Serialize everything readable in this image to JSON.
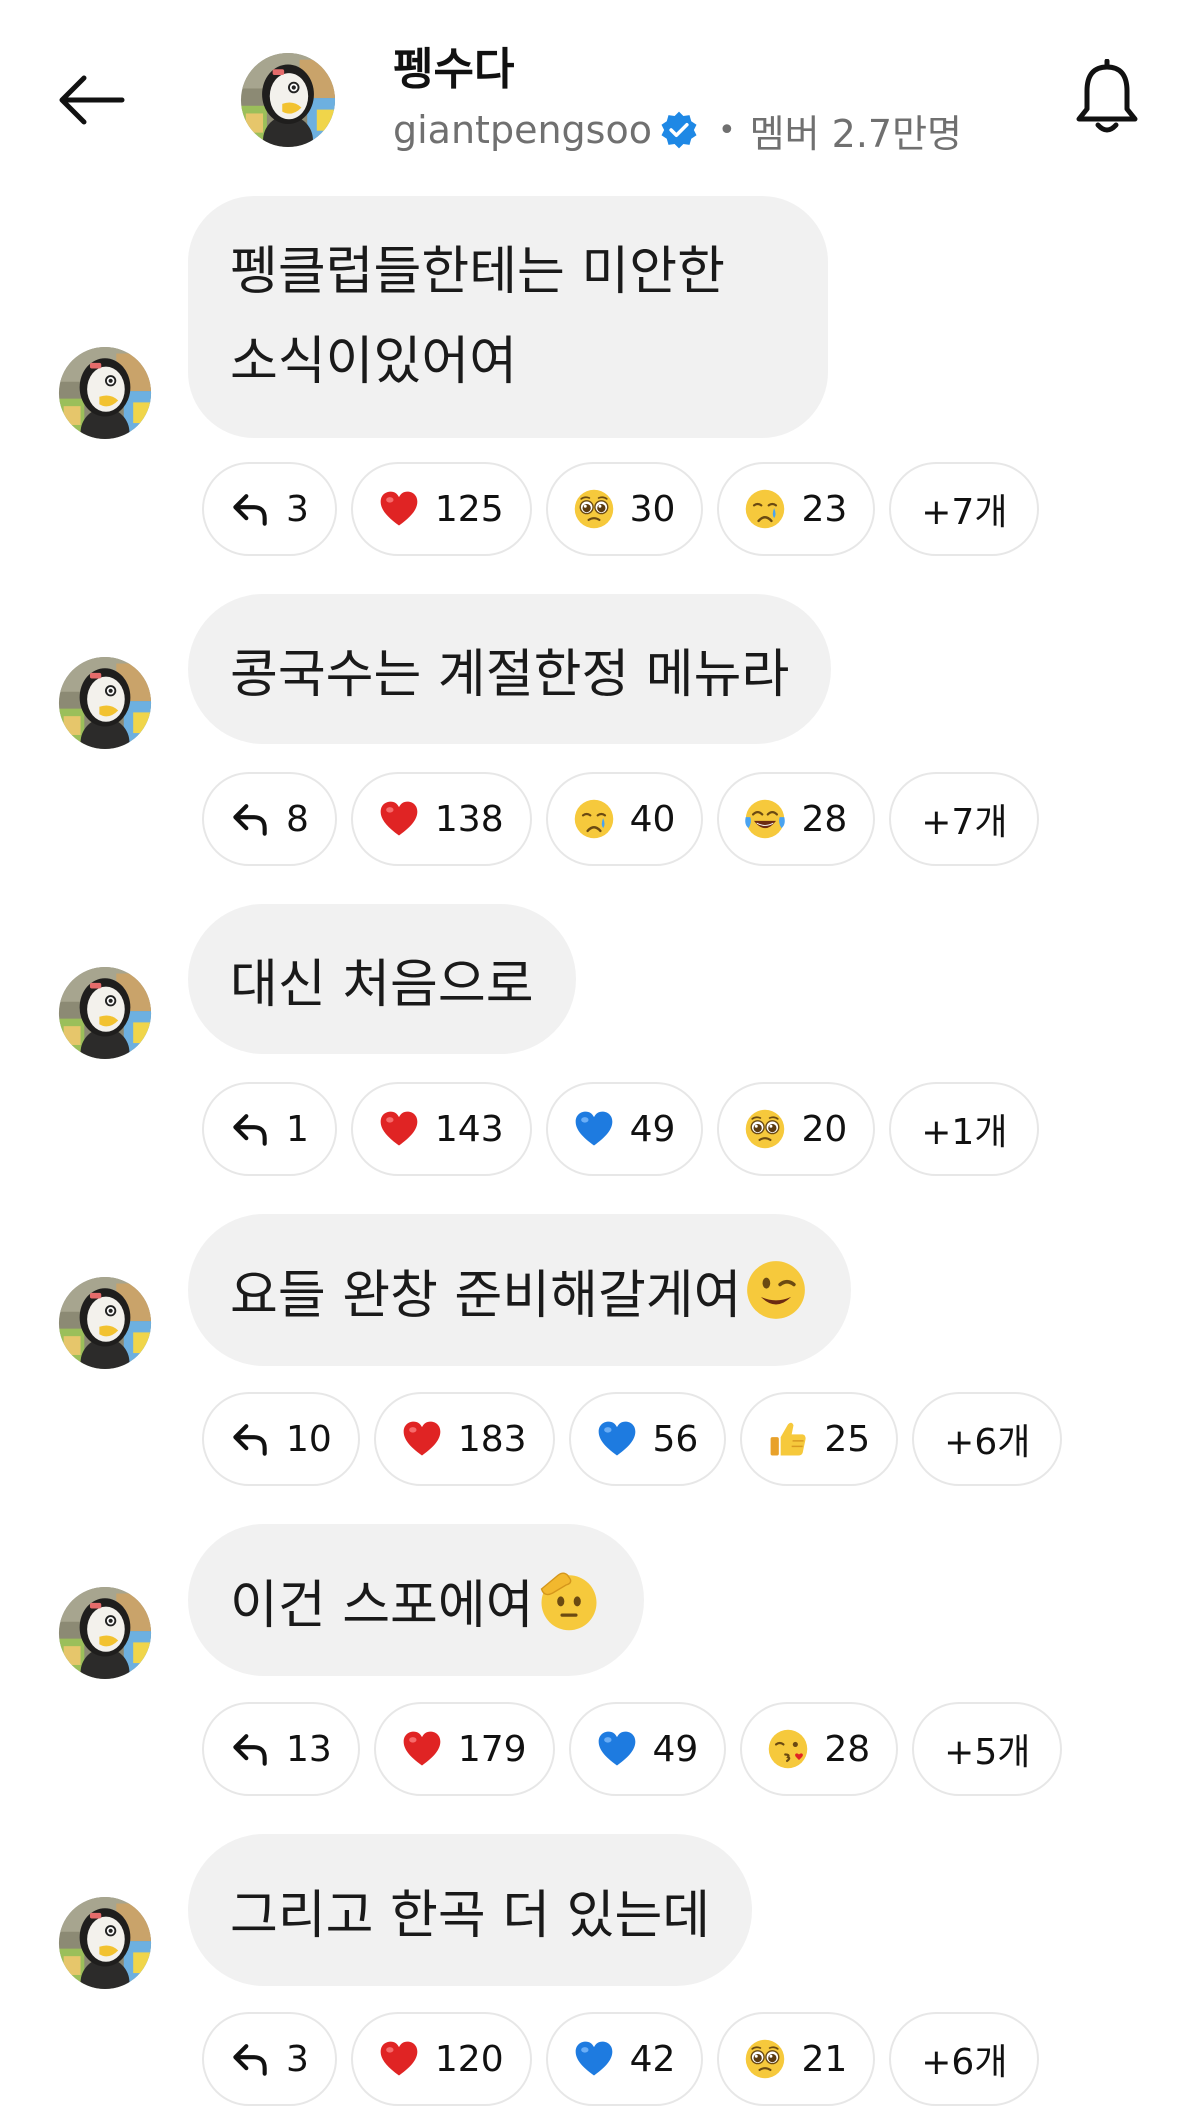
{
  "header": {
    "title": "펭수다",
    "handle": "giantpengsoo",
    "member_text": "멤버 2.7만명",
    "separator": "•"
  },
  "colors": {
    "bubble": "#f1f1f1",
    "verified": "#1e88e5",
    "heart_red": "#e02424",
    "heart_blue": "#1e7be0",
    "meta_gray": "#707070"
  },
  "messages": [
    {
      "text_lines": [
        "펭클럽들한테는 미안한",
        "소식이있어여"
      ],
      "reactions": [
        {
          "icon": "reply-icon",
          "count": "3"
        },
        {
          "icon": "red-heart-emoji",
          "count": "125"
        },
        {
          "icon": "pleading-face-emoji",
          "count": "30"
        },
        {
          "icon": "crying-face-emoji",
          "count": "23"
        }
      ],
      "more": "+7개"
    },
    {
      "text": "콩국수는 계절한정 메뉴라",
      "reactions": [
        {
          "icon": "reply-icon",
          "count": "8"
        },
        {
          "icon": "red-heart-emoji",
          "count": "138"
        },
        {
          "icon": "crying-face-emoji",
          "count": "40"
        },
        {
          "icon": "tears-of-joy-emoji",
          "count": "28"
        }
      ],
      "more": "+7개"
    },
    {
      "text": "대신 처음으로",
      "reactions": [
        {
          "icon": "reply-icon",
          "count": "1"
        },
        {
          "icon": "red-heart-emoji",
          "count": "143"
        },
        {
          "icon": "blue-heart-emoji",
          "count": "49"
        },
        {
          "icon": "pleading-face-emoji",
          "count": "20"
        }
      ],
      "more": "+1개"
    },
    {
      "text": "요들 완창 준비해갈게여",
      "emoji": "winking-face-emoji",
      "reactions": [
        {
          "icon": "reply-icon",
          "count": "10"
        },
        {
          "icon": "red-heart-emoji",
          "count": "183"
        },
        {
          "icon": "blue-heart-emoji",
          "count": "56"
        },
        {
          "icon": "thumbs-up-emoji",
          "count": "25"
        }
      ],
      "more": "+6개"
    },
    {
      "text": "이건 스포에여",
      "emoji": "saluting-face-emoji",
      "reactions": [
        {
          "icon": "reply-icon",
          "count": "13"
        },
        {
          "icon": "red-heart-emoji",
          "count": "179"
        },
        {
          "icon": "blue-heart-emoji",
          "count": "49"
        },
        {
          "icon": "face-blowing-kiss-emoji",
          "count": "28"
        }
      ],
      "more": "+5개"
    },
    {
      "text": "그리고 한곡 더 있는데",
      "reactions": [
        {
          "icon": "reply-icon",
          "count": "3"
        },
        {
          "icon": "red-heart-emoji",
          "count": "120"
        },
        {
          "icon": "blue-heart-emoji",
          "count": "42"
        },
        {
          "icon": "pleading-face-emoji",
          "count": "21"
        }
      ],
      "more": "+6개"
    }
  ]
}
